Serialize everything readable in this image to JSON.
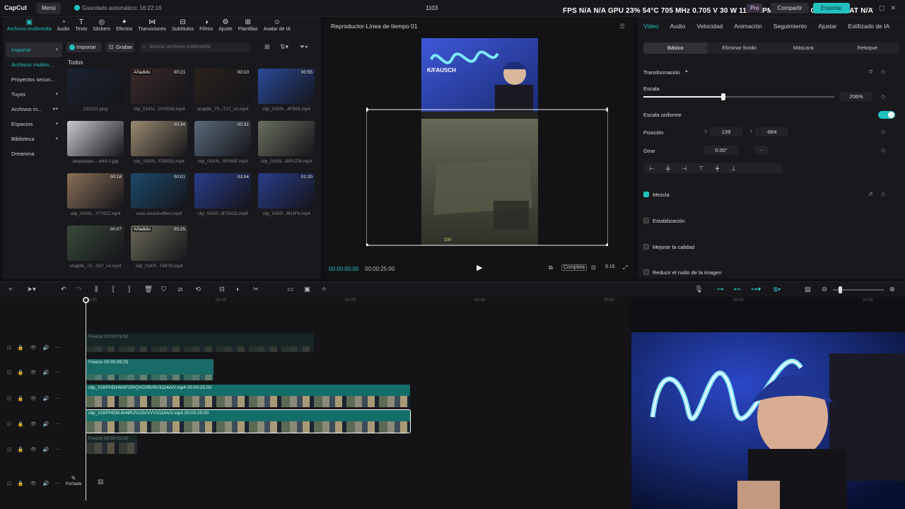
{
  "app": {
    "logo": "CapCut",
    "menu": "Menú",
    "autosave": "Guardado automático: 16:22:16",
    "project": "1103",
    "pro": "Pro",
    "share": "Compartir",
    "export": "Exportar"
  },
  "stats": "FPS N/A N/A   GPU 23% 54°C 705 MHz 0.705 V 30 W 1160 RPM 5000 MHz   CPU 23%   LAT N/A",
  "media_tabs": [
    {
      "label": "Archivos multimedia",
      "icon": "media-icon"
    },
    {
      "label": "Audio",
      "icon": "audio-icon"
    },
    {
      "label": "Texto",
      "icon": "text-icon"
    },
    {
      "label": "Stickers",
      "icon": "sticker-icon"
    },
    {
      "label": "Efectos",
      "icon": "effects-icon"
    },
    {
      "label": "Transiciones",
      "icon": "transition-icon"
    },
    {
      "label": "Subtítulos",
      "icon": "subtitle-icon"
    },
    {
      "label": "Filtros",
      "icon": "filter-icon"
    },
    {
      "label": "Ajuste",
      "icon": "adjust-icon"
    },
    {
      "label": "Plantillas",
      "icon": "template-icon"
    },
    {
      "label": "Avatar de IA",
      "icon": "avatar-icon"
    }
  ],
  "sidenav": [
    "Importar",
    "Archivos multim...",
    "Proyectos secun...",
    "Tuyos",
    "Archivos m...",
    "Espacios",
    "Biblioteca",
    "Dreamina"
  ],
  "media_toolbar": {
    "import": "Importar",
    "record": "Grabar",
    "search_placeholder": "Buscar archivos multimedia"
  },
  "todos": "Todos",
  "media": [
    {
      "name": "222221.png",
      "dur": "",
      "added": "",
      "bg": "#1c2230"
    },
    {
      "name": "clip_01KN...DY0GW.mp4",
      "dur": "00:21",
      "added": "Añadido",
      "bg": "#3a2a2a"
    },
    {
      "name": "snaptik_75...717_v3.mp4",
      "dur": "00:10",
      "added": "",
      "bg": "#2a221c"
    },
    {
      "name": "clip_01KN...4F893.mp4",
      "dur": "00:55",
      "added": "",
      "bg": "#2b4b9a"
    },
    {
      "name": "elepantalo...-640-0.jpg",
      "dur": "",
      "added": "",
      "bg": "#c9c9cf"
    },
    {
      "name": "clip_01KN...FDBSG.mp4",
      "dur": "00:34",
      "added": "",
      "bg": "#9a8a70"
    },
    {
      "name": "clip_01KN...SFHNF.mp4",
      "dur": "00:31",
      "added": "",
      "bg": "#5a6a7a"
    },
    {
      "name": "clip_01KN...BRVZW.mp4",
      "dur": "",
      "added": "",
      "bg": "#6a7060"
    },
    {
      "name": "clip_01KN...Y7YDZ.mp4",
      "dur": "00:18",
      "added": "",
      "bg": "#8a7058"
    },
    {
      "name": "core-sound-effect.mp3",
      "dur": "00:01",
      "added": "",
      "bg": "#1d4a6a"
    },
    {
      "name": "clip_01KP...BTGGD.mp4",
      "dur": "03:04",
      "added": "",
      "bg": "#2a3c8a"
    },
    {
      "name": "clip_01KP...8HJF6.mp4",
      "dur": "01:20",
      "added": "",
      "bg": "#2a3c8a"
    },
    {
      "name": "snaptik_73...037_v3.mp4",
      "dur": "00:07",
      "added": "",
      "bg": "#3a4a3a"
    },
    {
      "name": "clip_01KP...T8479.mp4",
      "dur": "00:25",
      "added": "Añadido",
      "bg": "#6a6858"
    }
  ],
  "preview": {
    "title": "Reproductor-Línea de tiempo 01",
    "current": "00:00:00:00",
    "total": "00:00:25:00",
    "full": "Completa",
    "ratio": "9:16",
    "watermark": "K/FAUSCH"
  },
  "props": {
    "tabs": [
      "Video",
      "Audio",
      "Velocidad",
      "Animación",
      "Seguimiento",
      "Ajustar",
      "Estilizado de IA"
    ],
    "subtabs": [
      "Básico",
      "Eliminar fondo",
      "Máscara",
      "Retoque"
    ],
    "transform": "Transformación",
    "scale_label": "Escala",
    "scale_value": "206%",
    "scale_fraction": 0.42,
    "uniform": "Escala uniforme",
    "position": "Posición",
    "pos_x_label": "X",
    "pos_x": "139",
    "pos_y_label": "Y",
    "pos_y": "-664",
    "rotate": "Girar",
    "rotate_value": "0.00°",
    "rotate_dash": "-",
    "blend": "Mezcla",
    "stab": "Estabilización",
    "quality": "Mejorar la calidad",
    "noise": "Reducir el ruido de la imagen"
  },
  "timeline": {
    "ticks": [
      "00:00",
      "00:10",
      "00:20",
      "00:30",
      "00:40",
      "00:50",
      "01:00"
    ],
    "clips": [
      {
        "label": "Freeze  00:00:01:00",
        "faded": true
      },
      {
        "label": "Freeze  00:00:09:25",
        "faded": false
      },
      {
        "label": "clip_01KPHDHM3FGRQVC09V9V3114A/V.mp4  00:00:25:00",
        "faded": false
      },
      {
        "label": "clip_01KPHDM.6H4RJVU3VVVV3114A/V.mp4  00:00:25:00",
        "faded": false
      },
      {
        "label": "Freeze  00:00:02:00",
        "faded": true
      }
    ],
    "portada": "Portada"
  }
}
